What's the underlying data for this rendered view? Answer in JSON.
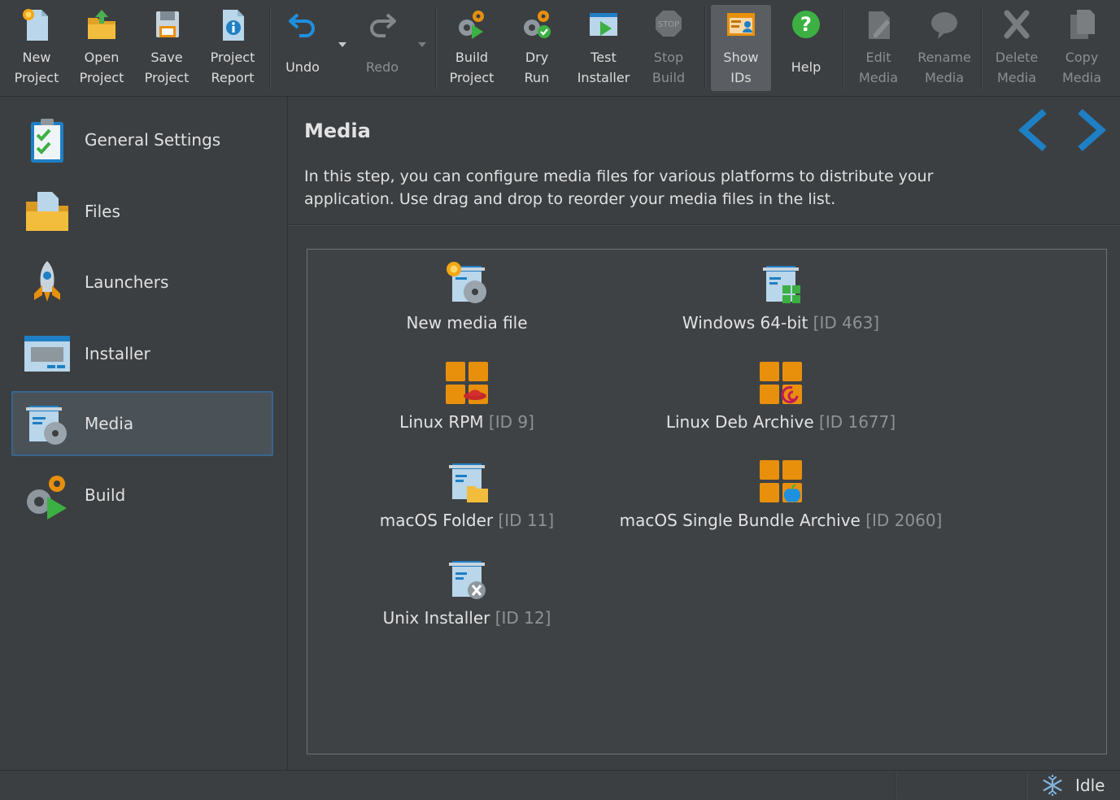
{
  "toolbar": {
    "new_project": "New\nProject",
    "open_project": "Open\nProject",
    "save_project": "Save\nProject",
    "project_report": "Project\nReport",
    "undo": "Undo",
    "redo": "Redo",
    "build_project": "Build\nProject",
    "dry_run": "Dry\nRun",
    "test_installer": "Test\nInstaller",
    "stop_build": "Stop\nBuild",
    "stop_sign_text": "STOP",
    "show_ids": "Show\nIDs",
    "help": "Help",
    "edit_media": "Edit\nMedia",
    "rename_media": "Rename\nMedia",
    "delete_media": "Delete\nMedia",
    "copy_media": "Copy\nMedia"
  },
  "sidebar": {
    "items": [
      {
        "label": "General Settings",
        "icon": "checklist-icon"
      },
      {
        "label": "Files",
        "icon": "folder-files-icon"
      },
      {
        "label": "Launchers",
        "icon": "rocket-icon"
      },
      {
        "label": "Installer",
        "icon": "installer-window-icon"
      },
      {
        "label": "Media",
        "icon": "media-disc-icon",
        "selected": true
      },
      {
        "label": "Build",
        "icon": "build-gears-icon"
      }
    ]
  },
  "main": {
    "title": "Media",
    "description": "In this step, you can configure media files for various platforms to distribute your application. Use drag and drop to reorder your media files in the list.",
    "media": [
      {
        "name": "New media file",
        "id": ""
      },
      {
        "name": "Windows 64-bit",
        "id": "[ID 463]"
      },
      {
        "name": "Linux RPM",
        "id": "[ID 9]"
      },
      {
        "name": "Linux Deb Archive",
        "id": "[ID 1677]"
      },
      {
        "name": "macOS Folder",
        "id": "[ID 11]"
      },
      {
        "name": "macOS Single Bundle Archive",
        "id": "[ID 2060]"
      },
      {
        "name": "Unix Installer",
        "id": "[ID 12]"
      }
    ]
  },
  "status": {
    "text": "Idle",
    "icon": "snowflake-icon"
  },
  "colors": {
    "background": "#3c3f41",
    "accent_blue": "#1f7fc4",
    "selection_border": "#35668f",
    "orange": "#e8900c"
  }
}
